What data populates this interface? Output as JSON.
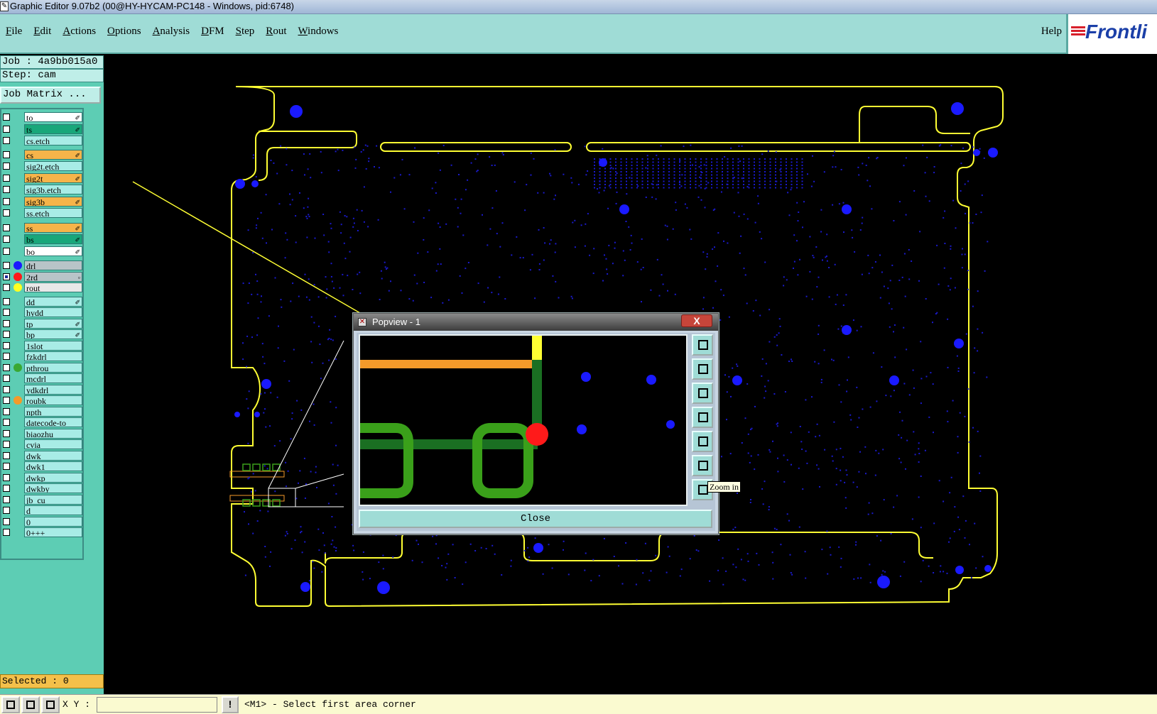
{
  "window": {
    "title": "Graphic Editor 9.07b2 (00@HY-HYCAM-PC148 - Windows, pid:6748)"
  },
  "menubar": {
    "items": [
      "File",
      "Edit",
      "Actions",
      "Options",
      "Analysis",
      "DFM",
      "Step",
      "Rout",
      "Windows"
    ],
    "help": "Help",
    "logo_text": "Frontli"
  },
  "sidebar": {
    "job_line": "Job : 4a9bb015a0",
    "step_line": "Step: cam",
    "job_matrix_button": "Job Matrix ...",
    "selected_line": "Selected : 0",
    "layers": [
      {
        "name": "to",
        "color": "#ffffff",
        "dot": null,
        "mark": "✐",
        "checked": false
      },
      {
        "name": "ts",
        "color": "#19a77a",
        "dot": null,
        "mark": "✐",
        "checked": false
      },
      {
        "name": "cs.etch",
        "color": "#a8ece6",
        "dot": null,
        "mark": "",
        "checked": false
      },
      {
        "name": "cs",
        "color": "#f6b44a",
        "dot": null,
        "mark": "✐",
        "checked": false
      },
      {
        "name": "sig2t.etch",
        "color": "#a8ece6",
        "dot": null,
        "mark": "",
        "checked": false
      },
      {
        "name": "sig2t",
        "color": "#f6b44a",
        "dot": null,
        "mark": "✐",
        "checked": false
      },
      {
        "name": "sig3b.etch",
        "color": "#a8ece6",
        "dot": null,
        "mark": "",
        "checked": false
      },
      {
        "name": "sig3b",
        "color": "#f6b44a",
        "dot": null,
        "mark": "✐",
        "checked": false
      },
      {
        "name": "ss.etch",
        "color": "#a8ece6",
        "dot": null,
        "mark": "",
        "checked": false
      },
      {
        "name": "ss",
        "color": "#f6b44a",
        "dot": null,
        "mark": "✐",
        "checked": false
      },
      {
        "name": "bs",
        "color": "#19a77a",
        "dot": null,
        "mark": "✐",
        "checked": false
      },
      {
        "name": "bo",
        "color": "#ffffff",
        "dot": null,
        "mark": "✐",
        "checked": false
      },
      {
        "name": "drl",
        "color": "#b8c4c8",
        "dot": "#1a1aff",
        "mark": "",
        "checked": false
      },
      {
        "name": "2rd",
        "color": "#b8c4c8",
        "dot": "#ff1a1a",
        "mark": "▫",
        "checked": true
      },
      {
        "name": "rout",
        "color": "#e8e8e8",
        "dot": "#ffff22",
        "mark": "",
        "checked": false
      },
      {
        "name": "dd",
        "color": "#a8ece6",
        "dot": null,
        "mark": "✐",
        "checked": false
      },
      {
        "name": "hydd",
        "color": "#a8ece6",
        "dot": null,
        "mark": "",
        "checked": false
      },
      {
        "name": "tp",
        "color": "#a8ece6",
        "dot": null,
        "mark": "✐",
        "checked": false
      },
      {
        "name": "bp",
        "color": "#a8ece6",
        "dot": null,
        "mark": "✐",
        "checked": false
      },
      {
        "name": "1slot",
        "color": "#a8ece6",
        "dot": null,
        "mark": "",
        "checked": false
      },
      {
        "name": "fzkdrl",
        "color": "#a8ece6",
        "dot": null,
        "mark": "",
        "checked": false
      },
      {
        "name": "pthrou",
        "color": "#a8ece6",
        "dot": "#3aa832",
        "mark": "",
        "checked": false
      },
      {
        "name": "mcdrl",
        "color": "#a8ece6",
        "dot": null,
        "mark": "",
        "checked": false
      },
      {
        "name": "ydkdrl",
        "color": "#a8ece6",
        "dot": null,
        "mark": "",
        "checked": false
      },
      {
        "name": "roubk",
        "color": "#a8ece6",
        "dot": "#f49a2a",
        "mark": "",
        "checked": false
      },
      {
        "name": "npth",
        "color": "#a8ece6",
        "dot": null,
        "mark": "",
        "checked": false
      },
      {
        "name": "datecode-to",
        "color": "#a8ece6",
        "dot": null,
        "mark": "",
        "checked": false
      },
      {
        "name": "biaozhu",
        "color": "#a8ece6",
        "dot": null,
        "mark": "",
        "checked": false
      },
      {
        "name": "cvia",
        "color": "#a8ece6",
        "dot": null,
        "mark": "",
        "checked": false
      },
      {
        "name": "dwk",
        "color": "#a8ece6",
        "dot": null,
        "mark": "",
        "checked": false
      },
      {
        "name": "dwk1",
        "color": "#a8ece6",
        "dot": null,
        "mark": "",
        "checked": false
      },
      {
        "name": "dwkp",
        "color": "#a8ece6",
        "dot": null,
        "mark": "",
        "checked": false
      },
      {
        "name": "dwkby",
        "color": "#a8ece6",
        "dot": null,
        "mark": "",
        "checked": false
      },
      {
        "name": "jb_cu",
        "color": "#a8ece6",
        "dot": null,
        "mark": "",
        "checked": false
      },
      {
        "name": "d",
        "color": "#a8ece6",
        "dot": null,
        "mark": "",
        "checked": false
      },
      {
        "name": "0",
        "color": "#a8ece6",
        "dot": null,
        "mark": "",
        "checked": false
      },
      {
        "name": "0+++",
        "color": "#a8ece6",
        "dot": null,
        "mark": "",
        "checked": false
      }
    ]
  },
  "popview": {
    "title": "Popview - 1",
    "close_x": "X",
    "close_button": "Close",
    "tooltip": "Zoom in",
    "tools": [
      "zoom-fit-icon",
      "pan-up-icon",
      "pan-down-icon",
      "pan-left-icon",
      "pan-right-icon",
      "zoom-in-icon",
      "zoom-out-icon"
    ]
  },
  "statusbar": {
    "xy_label": "X Y :",
    "xy_value": "",
    "message_button": "!",
    "message": "<M1> - Select first area corner"
  },
  "colors": {
    "board_outline": "#ffff33",
    "pads": "#1a1aff",
    "vias": "#1a1acc",
    "menubar": "#9fdcd6",
    "sidebar": "#5dcdb4"
  }
}
